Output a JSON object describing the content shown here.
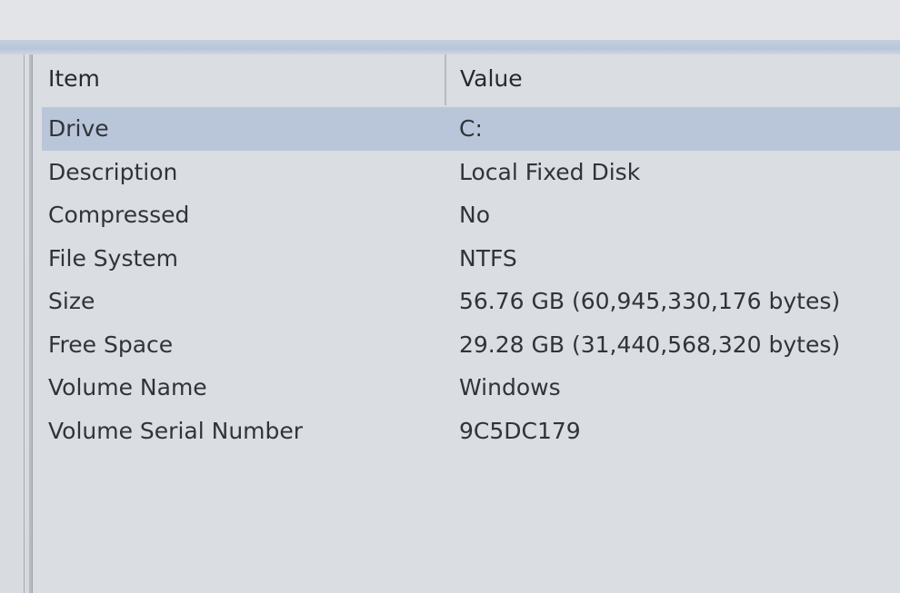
{
  "columns": {
    "item": "Item",
    "value": "Value"
  },
  "rows": [
    {
      "item": "Drive",
      "value": "C:",
      "selected": true
    },
    {
      "item": "Description",
      "value": "Local Fixed Disk",
      "selected": false
    },
    {
      "item": "Compressed",
      "value": "No",
      "selected": false
    },
    {
      "item": "File System",
      "value": "NTFS",
      "selected": false
    },
    {
      "item": "Size",
      "value": "56.76 GB (60,945,330,176 bytes)",
      "selected": false
    },
    {
      "item": "Free Space",
      "value": "29.28 GB (31,440,568,320 bytes)",
      "selected": false
    },
    {
      "item": "Volume Name",
      "value": "Windows",
      "selected": false
    },
    {
      "item": "Volume Serial Number",
      "value": "9C5DC179",
      "selected": false
    }
  ],
  "colors": {
    "selection": "#b9c6da",
    "background": "#dadde1",
    "text": "#30343a"
  }
}
